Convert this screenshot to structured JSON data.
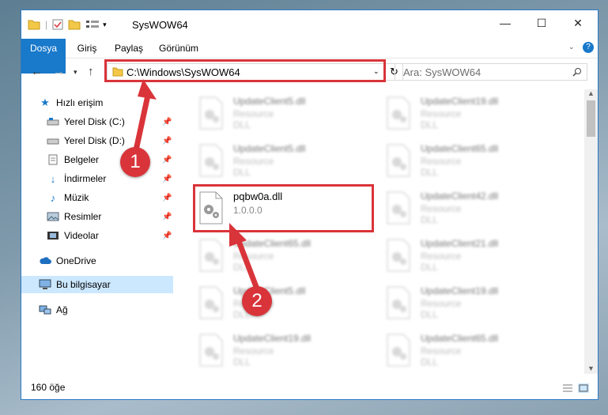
{
  "window": {
    "title": "SysWOW64"
  },
  "ribbon": {
    "tabs": [
      "Dosya",
      "Giriş",
      "Paylaş",
      "Görünüm"
    ]
  },
  "address": {
    "path": "C:\\Windows\\SysWOW64"
  },
  "search": {
    "placeholder": "Ara: SysWOW64"
  },
  "sidebar": {
    "items": [
      {
        "label": "Hızlı erişim",
        "icon": "star-icon",
        "pinned": false
      },
      {
        "label": "Yerel Disk (C:)",
        "icon": "drive-icon",
        "pinned": true
      },
      {
        "label": "Yerel Disk (D:)",
        "icon": "drive-icon",
        "pinned": true
      },
      {
        "label": "Belgeler",
        "icon": "document-icon",
        "pinned": true
      },
      {
        "label": "İndirmeler",
        "icon": "download-icon",
        "pinned": true
      },
      {
        "label": "Müzik",
        "icon": "music-icon",
        "pinned": true
      },
      {
        "label": "Resimler",
        "icon": "pictures-icon",
        "pinned": true
      },
      {
        "label": "Videolar",
        "icon": "video-icon",
        "pinned": true
      },
      {
        "label": "OneDrive",
        "icon": "cloud-icon",
        "pinned": false
      },
      {
        "label": "Bu bilgisayar",
        "icon": "computer-icon",
        "pinned": false,
        "selected": true
      },
      {
        "label": "Ağ",
        "icon": "network-icon",
        "pinned": false
      }
    ]
  },
  "files": {
    "col1": [
      {
        "name": "UpdateClient5.dll",
        "desc": "Resource DLL"
      },
      {
        "name": "UpdateClient5.dll",
        "desc": "Resource DLL"
      },
      {
        "name": "pqbw0a.dll",
        "desc": "1.0.0.0",
        "highlight": true
      },
      {
        "name": "UpdateClient65.dll",
        "desc": "Resource DLL"
      },
      {
        "name": "UpdateClient5.dll",
        "desc": "Resource DLL"
      },
      {
        "name": "UpdateClient19.dll",
        "desc": "Resource DLL"
      }
    ],
    "col2": [
      {
        "name": "UpdateClient19.dll",
        "desc": "Resource DLL"
      },
      {
        "name": "UpdateClient65.dll",
        "desc": "Resource DLL"
      },
      {
        "name": "UpdateClient42.dll",
        "desc": "Resource DLL"
      },
      {
        "name": "UpdateClient21.dll",
        "desc": "Resource DLL"
      },
      {
        "name": "UpdateClient19.dll",
        "desc": "Resource DLL"
      },
      {
        "name": "UpdateClient65.dll",
        "desc": "Resource DLL"
      }
    ]
  },
  "status": {
    "count": "160 öğe"
  },
  "callouts": [
    "1",
    "2"
  ],
  "colors": {
    "accent": "#1979ca",
    "highlight": "#d9343a"
  }
}
